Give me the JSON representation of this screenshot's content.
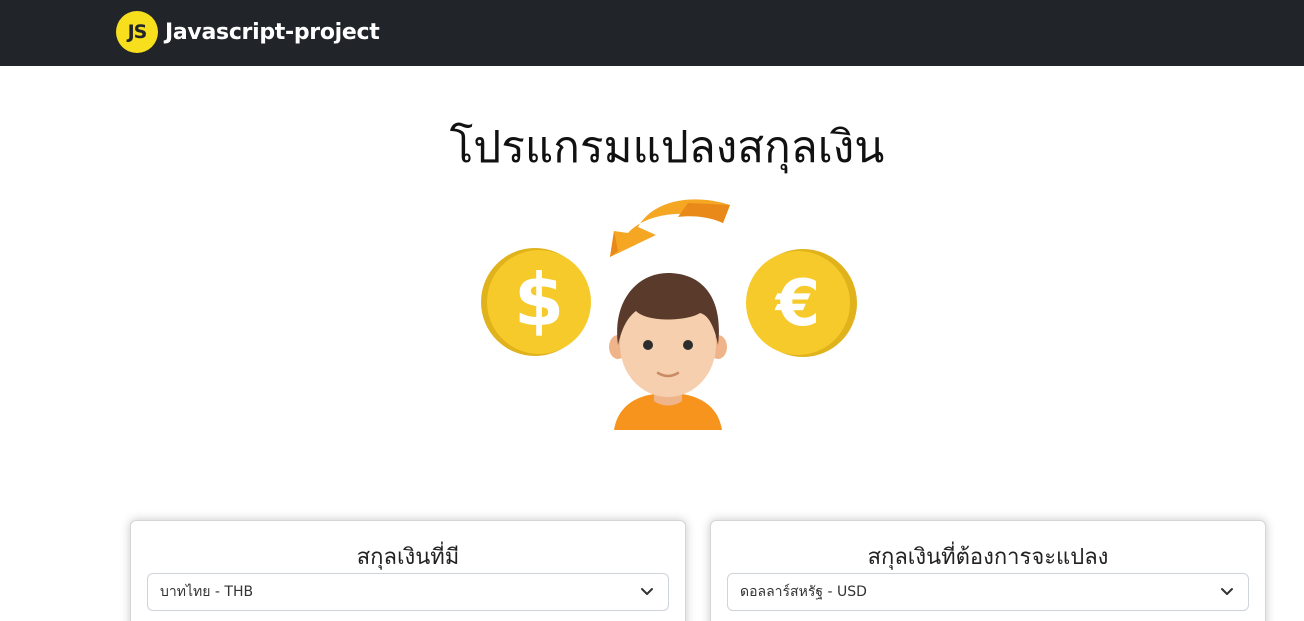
{
  "navbar": {
    "logo_text": "JS",
    "brand": "Javascript-project"
  },
  "page": {
    "title": "โปรแกรมแปลงสกุลเงิน"
  },
  "illustration": {
    "icons": [
      "dollar-coin-icon",
      "euro-coin-icon",
      "exchange-arrow-icon",
      "person-icon"
    ],
    "colors": {
      "coin": "#f6ca2b",
      "coin_edge": "#e0b21c",
      "arrow": "#f5a623",
      "hair": "#5a3a2a",
      "skin": "#f6d0ae",
      "shirt": "#f7941d"
    }
  },
  "converter": {
    "from": {
      "label": "สกุลเงินที่มี",
      "selected": "บาทไทย - THB"
    },
    "to": {
      "label": "สกุลเงินที่ต้องการจะแปลง",
      "selected": "ดอลลาร์สหรัฐ - USD"
    }
  },
  "colors": {
    "navbar_bg": "#212529",
    "js_logo": "#f7df1e"
  }
}
